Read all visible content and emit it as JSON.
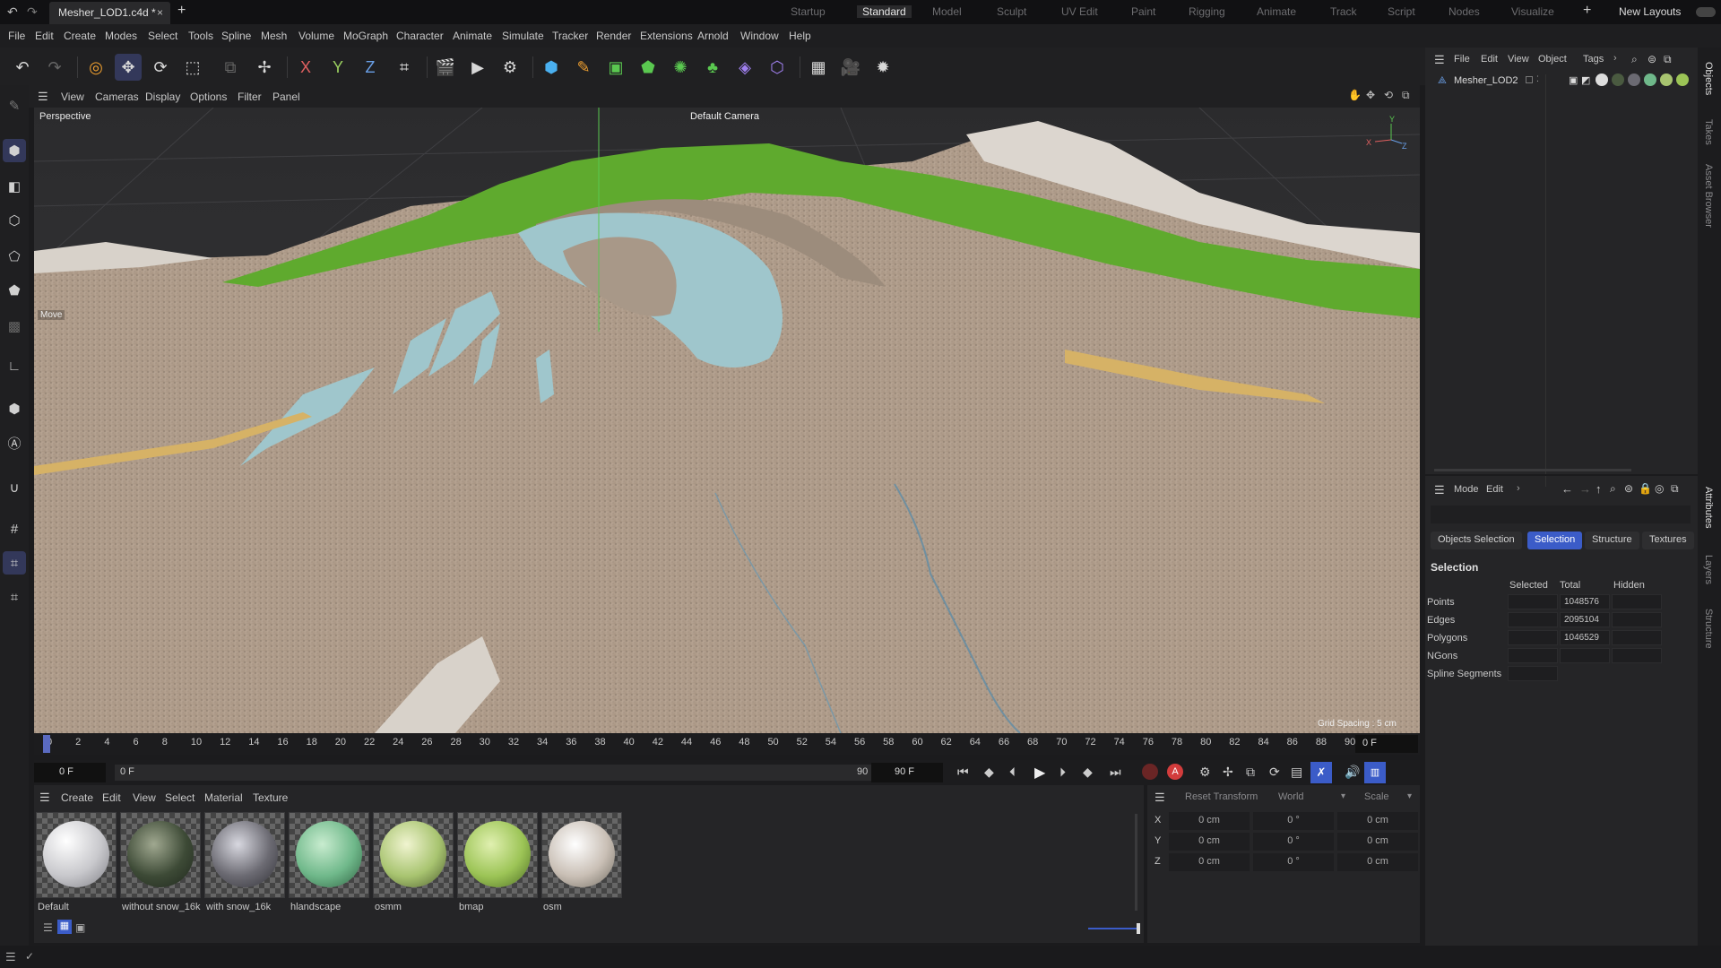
{
  "document_tab": {
    "title": "Mesher_LOD1.c4d *",
    "close": "×"
  },
  "layouts": [
    "Startup",
    "Standard",
    "Model",
    "Sculpt",
    "UV Edit",
    "Paint",
    "Rigging",
    "Animate",
    "Track",
    "Script",
    "Nodes",
    "Visualize"
  ],
  "active_layout": "Standard",
  "new_layouts_label": "New Layouts",
  "menu": [
    "File",
    "Edit",
    "Create",
    "Modes",
    "Select",
    "Tools",
    "Spline",
    "Mesh",
    "Volume",
    "MoGraph",
    "Character",
    "Animate",
    "Simulate",
    "Tracker",
    "Render",
    "Extensions",
    "Arnold",
    "Window",
    "Help"
  ],
  "toolbar_axes": {
    "x": "X",
    "y": "Y",
    "z": "Z"
  },
  "viewport_menu": [
    "View",
    "Cameras",
    "Display",
    "Options",
    "Filter",
    "Panel"
  ],
  "viewport": {
    "projection_label": "Perspective",
    "camera_label": "Default Camera",
    "move_hint": "Move",
    "grid_spacing": "Grid Spacing : 5 cm",
    "axis": {
      "x": "X",
      "y": "Y",
      "z": "Z"
    }
  },
  "timeline": {
    "ticks": [
      "0",
      "2",
      "4",
      "6",
      "8",
      "10",
      "12",
      "14",
      "16",
      "18",
      "20",
      "22",
      "24",
      "26",
      "28",
      "30",
      "32",
      "34",
      "36",
      "38",
      "40",
      "42",
      "44",
      "46",
      "48",
      "50",
      "52",
      "54",
      "56",
      "58",
      "60",
      "62",
      "64",
      "66",
      "68",
      "70",
      "72",
      "74",
      "76",
      "78",
      "80",
      "82",
      "84",
      "86",
      "88",
      "90"
    ],
    "current_frame_display": "0 F"
  },
  "transport": {
    "start_frame": "0 F",
    "range_start": "0 F",
    "range_end": "90 F",
    "end_frame": "90 F"
  },
  "material_menu": [
    "Create",
    "Edit",
    "View",
    "Select",
    "Material",
    "Texture"
  ],
  "materials": [
    {
      "name": "Default",
      "color": "#e8e8ea"
    },
    {
      "name": "without snow_16k",
      "color": "#3d4a36"
    },
    {
      "name": "with snow_16k",
      "color": "#6b6a72"
    },
    {
      "name": "hlandscape",
      "color": "#6fb88a"
    },
    {
      "name": "osmm",
      "color": "#a8c470"
    },
    {
      "name": "bmap",
      "color": "#9cc456"
    },
    {
      "name": "osm",
      "color": "#c9bfb5"
    }
  ],
  "coordinates": {
    "reset_transform": "Reset Transform",
    "space": "World",
    "mode": "Scale",
    "rows": [
      {
        "axis": "X",
        "pos": "0 cm",
        "rot": "0 °",
        "size": "0 cm"
      },
      {
        "axis": "Y",
        "pos": "0 cm",
        "rot": "0 °",
        "size": "0 cm"
      },
      {
        "axis": "Z",
        "pos": "0 cm",
        "rot": "0 °",
        "size": "0 cm"
      }
    ]
  },
  "objects_panel": {
    "menu": [
      "File",
      "Edit",
      "View",
      "Object",
      "Tags"
    ],
    "object_name": "Mesher_LOD2"
  },
  "attributes_panel": {
    "menu": [
      "Mode",
      "Edit"
    ],
    "tabs": [
      "Objects Selection",
      "Selection",
      "Structure",
      "Textures"
    ],
    "active_tab": "Selection",
    "section_title": "Selection",
    "columns": [
      "Selected",
      "Total",
      "Hidden"
    ],
    "rows": [
      {
        "label": "Points",
        "selected": "",
        "total": "1048576",
        "hidden": ""
      },
      {
        "label": "Edges",
        "selected": "",
        "total": "2095104",
        "hidden": ""
      },
      {
        "label": "Polygons",
        "selected": "",
        "total": "1046529",
        "hidden": ""
      },
      {
        "label": "NGons",
        "selected": "",
        "total": "",
        "hidden": ""
      },
      {
        "label": "Spline Segments",
        "selected": "",
        "total": "",
        "hidden": ""
      }
    ]
  },
  "right_strip_tabs": [
    "Objects",
    "Takes",
    "Asset Browser",
    "Attributes",
    "Layers",
    "Structure"
  ],
  "colors": {
    "accent": "#3b5cc8",
    "record": "#d23c3c",
    "terrain_green": "#5faa2e",
    "terrain_water": "#9fc6cc"
  }
}
